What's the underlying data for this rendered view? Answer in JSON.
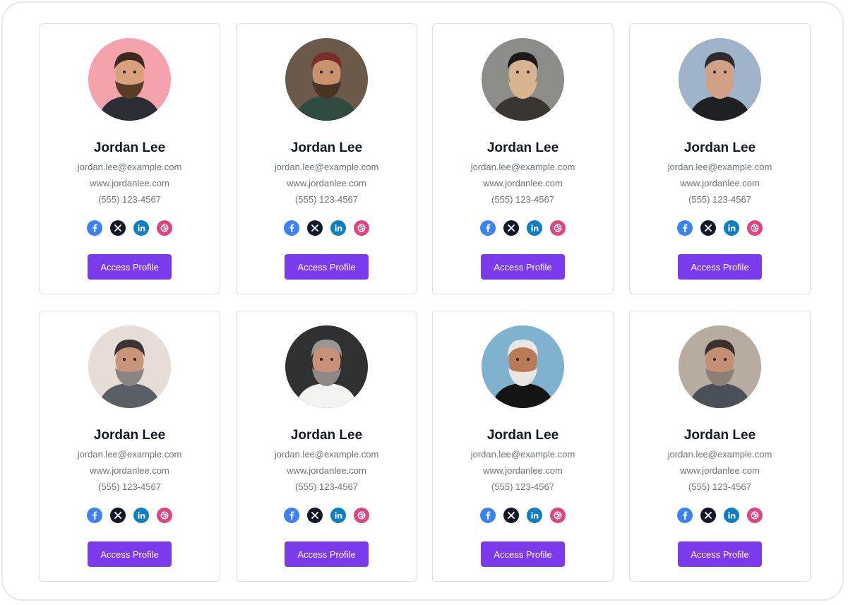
{
  "theme": {
    "accent": "#7c3aed",
    "facebook": "#3b82f6",
    "x": "#111827",
    "linkedin": "#0e7ec4",
    "dribbble": "#e0447f"
  },
  "social_icons": [
    "facebook-icon",
    "x-icon",
    "linkedin-icon",
    "dribbble-icon"
  ],
  "cards": [
    {
      "name": "Jordan Lee",
      "email": "jordan.lee@example.com",
      "website": "www.jordanlee.com",
      "phone": "(555) 123-4567",
      "button": "Access Profile",
      "photo": {
        "bg": "#f4a3ad",
        "skin": "#d9a07c",
        "hair": "#3b2a20",
        "shirt": "#2a2d33",
        "beard": "#5a3b26"
      }
    },
    {
      "name": "Jordan Lee",
      "email": "jordan.lee@example.com",
      "website": "www.jordanlee.com",
      "phone": "(555) 123-4567",
      "button": "Access Profile",
      "photo": {
        "bg": "#6b5a4a",
        "skin": "#c9936d",
        "hair": "#7a2d2a",
        "shirt": "#2f4a3e",
        "beard": "#4a3426"
      }
    },
    {
      "name": "Jordan Lee",
      "email": "jordan.lee@example.com",
      "website": "www.jordanlee.com",
      "phone": "(555) 123-4567",
      "button": "Access Profile",
      "photo": {
        "bg": "#8c8c88",
        "skin": "#d8b38f",
        "hair": "#1c1a1a",
        "shirt": "#3a3530",
        "beard": "#d8b38f"
      }
    },
    {
      "name": "Jordan Lee",
      "email": "jordan.lee@example.com",
      "website": "www.jordanlee.com",
      "phone": "(555) 123-4567",
      "button": "Access Profile",
      "photo": {
        "bg": "#9fb4c8",
        "skin": "#d0a184",
        "hair": "#2b2b30",
        "shirt": "#1f1f26",
        "beard": "#d0a184"
      }
    },
    {
      "name": "Jordan Lee",
      "email": "jordan.lee@example.com",
      "website": "www.jordanlee.com",
      "phone": "(555) 123-4567",
      "button": "Access Profile",
      "photo": {
        "bg": "#e6ddd6",
        "skin": "#c8957a",
        "hair": "#3a3533",
        "shirt": "#5a5f66",
        "beard": "#8a8580"
      }
    },
    {
      "name": "Jordan Lee",
      "email": "jordan.lee@example.com",
      "website": "www.jordanlee.com",
      "phone": "(555) 123-4567",
      "button": "Access Profile",
      "photo": {
        "bg": "#2f3133",
        "skin": "#c99278",
        "hair": "#9a9693",
        "shirt": "#f3f3f1",
        "beard": "#8e8986"
      }
    },
    {
      "name": "Jordan Lee",
      "email": "jordan.lee@example.com",
      "website": "www.jordanlee.com",
      "phone": "(555) 123-4567",
      "button": "Access Profile",
      "photo": {
        "bg": "#7fb2cf",
        "skin": "#b97a55",
        "hair": "#e8e6e2",
        "shirt": "#141414",
        "beard": "#e8e6e2"
      }
    },
    {
      "name": "Jordan Lee",
      "email": "jordan.lee@example.com",
      "website": "www.jordanlee.com",
      "phone": "(555) 123-4567",
      "button": "Access Profile",
      "photo": {
        "bg": "#b8aba0",
        "skin": "#c58f74",
        "hair": "#3a302c",
        "shirt": "#4a5058",
        "beard": "#8b7f76"
      }
    }
  ]
}
